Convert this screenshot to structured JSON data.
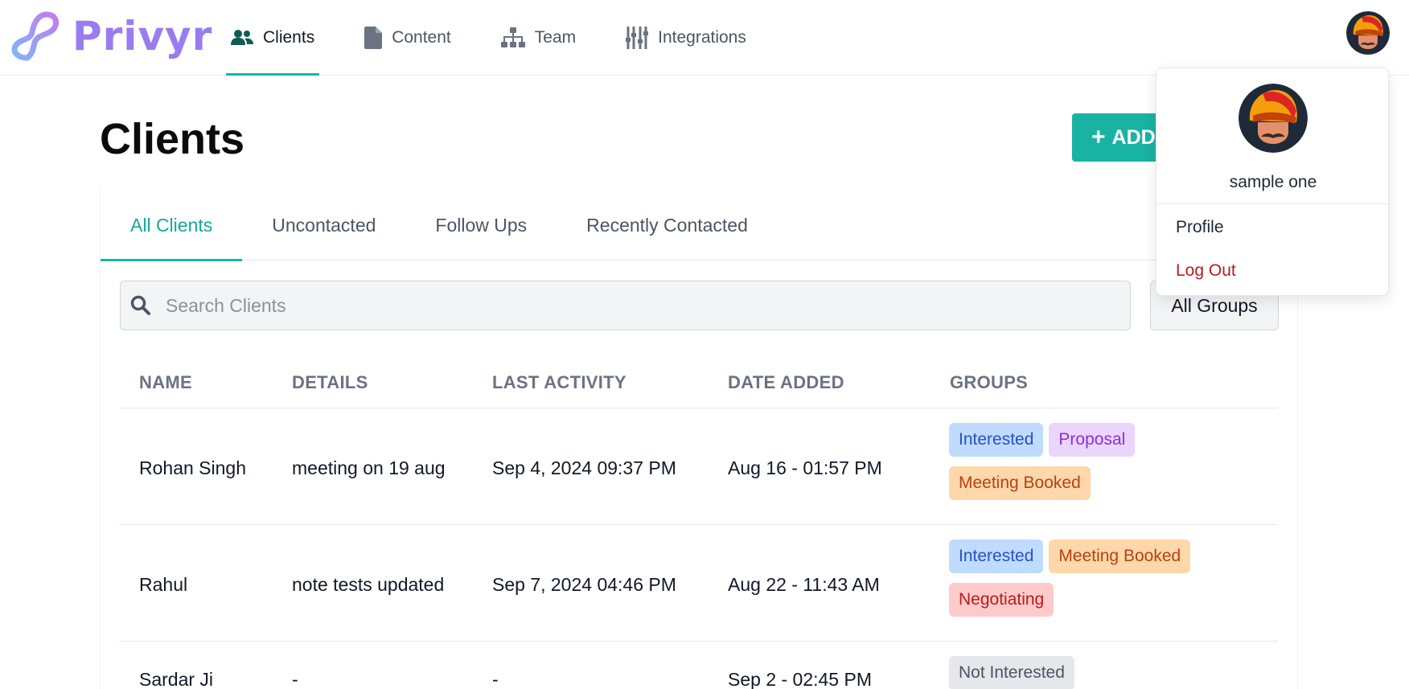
{
  "header": {
    "brand": "Privyr",
    "nav": [
      {
        "label": "Clients",
        "icon": "users-icon",
        "active": true
      },
      {
        "label": "Content",
        "icon": "file-icon",
        "active": false
      },
      {
        "label": "Team",
        "icon": "sitemap-icon",
        "active": false
      },
      {
        "label": "Integrations",
        "icon": "sliders-icon",
        "active": false
      }
    ],
    "avatar_icon": "turban-avatar-icon"
  },
  "main": {
    "title": "Clients",
    "add_button": "ADD",
    "tabs": [
      {
        "label": "All Clients",
        "active": true
      },
      {
        "label": "Uncontacted",
        "active": false
      },
      {
        "label": "Follow Ups",
        "active": false
      },
      {
        "label": "Recently Contacted",
        "active": false
      }
    ],
    "search": {
      "placeholder": "Search Clients",
      "value": ""
    },
    "groups_filter": "All Groups",
    "table": {
      "columns": [
        "NAME",
        "DETAILS",
        "LAST ACTIVITY",
        "DATE ADDED",
        "GROUPS"
      ],
      "rows": [
        {
          "name": "Rohan Singh",
          "details": "meeting on 19 aug",
          "last_activity": "Sep 4, 2024 09:37 PM",
          "date_added": "Aug 16 - 01:57 PM",
          "groups": [
            "Interested",
            "Proposal",
            "Meeting Booked"
          ]
        },
        {
          "name": "Rahul",
          "details": "note tests updated",
          "last_activity": "Sep 7, 2024 04:46 PM",
          "date_added": "Aug 22 - 11:43 AM",
          "groups": [
            "Interested",
            "Meeting Booked",
            "Negotiating"
          ]
        },
        {
          "name": "Sardar Ji",
          "details": "-",
          "last_activity": "-",
          "date_added": "Sep 2 - 02:45 PM",
          "groups": [
            "Not Interested"
          ]
        }
      ]
    }
  },
  "user_menu": {
    "name": "sample one",
    "items": [
      "Profile",
      "Log Out"
    ]
  },
  "colors": {
    "accent": "#14b8a6",
    "brand": "#9a7cf0",
    "logout": "#b91c1c"
  }
}
